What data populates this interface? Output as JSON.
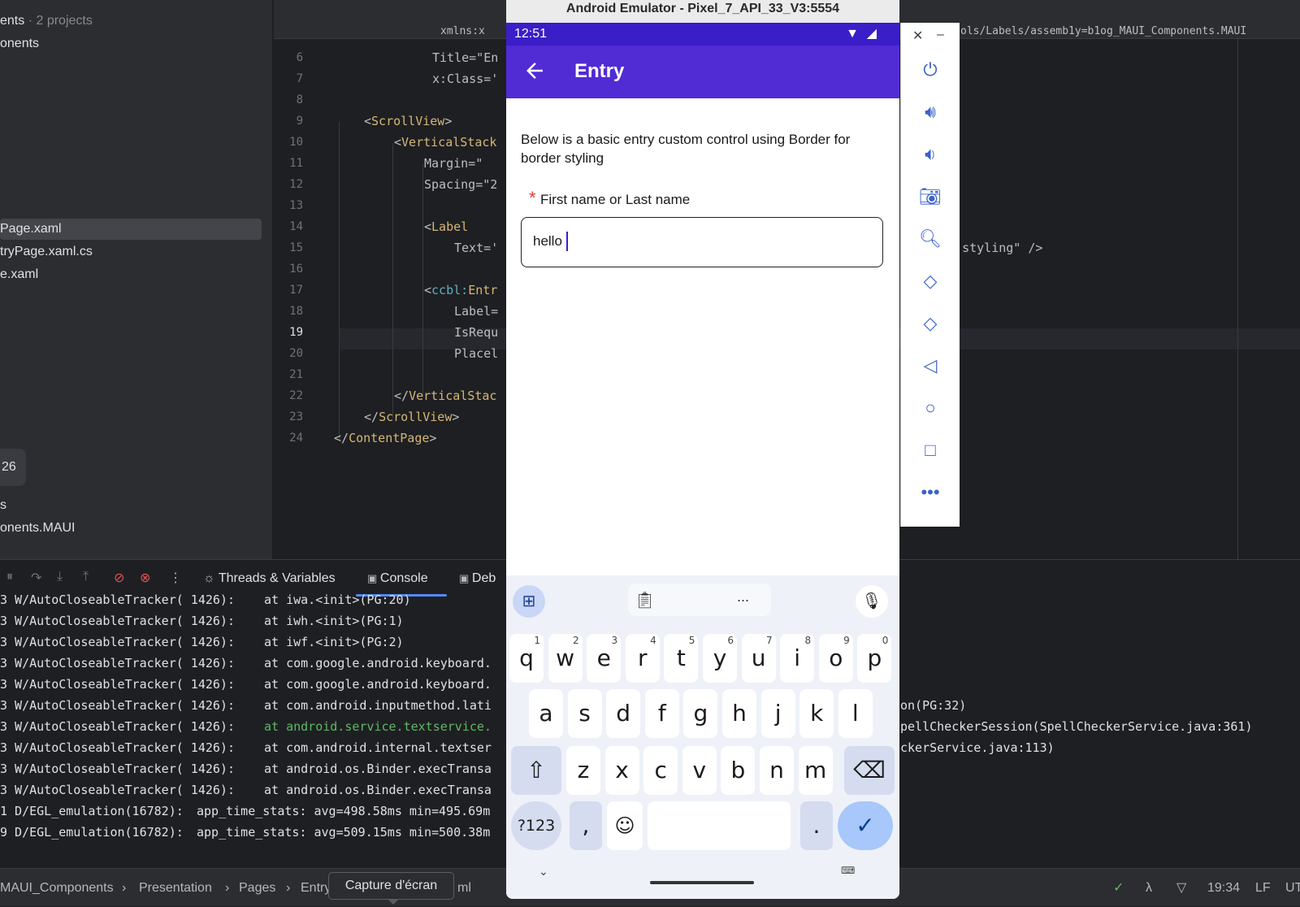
{
  "project_tree": {
    "header": "ents",
    "header_suffix": "· 2 projects",
    "items": [
      "onents",
      "Page.xaml",
      "tryPage.xaml.cs",
      "e.xaml",
      "26",
      "s",
      "onents.MAUI"
    ]
  },
  "editor": {
    "line_numbers": [
      "6",
      "7",
      "8",
      "9",
      "10",
      "11",
      "12",
      "13",
      "14",
      "15",
      "16",
      "17",
      "18",
      "19",
      "20",
      "21",
      "22",
      "23",
      "24"
    ],
    "current_line": "19",
    "top_fragment": "xmlns:x",
    "top_right_fragment": "ols/Labels/assemb1y=b1og_MAUI_Components.MAUI",
    "lines": {
      "l6": "Title=\"En",
      "l7": "x:Class='",
      "l9_tag": "ScrollView",
      "l10_tag": "VerticalStack",
      "l11": "Margin=\"",
      "l12": "Spacing=\"2",
      "l14_tag": "Label",
      "l15": "Text='",
      "l15_right": "er styling\" />",
      "l17_prefix": "ccbl:",
      "l17_tag": "Entr",
      "l18": "Label=",
      "l19": "IsRequ",
      "l20": "Placel",
      "l22_tag": "VerticalStac",
      "l23_tag": "ScrollView",
      "l24_tag": "ContentPage"
    }
  },
  "debug": {
    "tabs": {
      "threads": "Threads & Variables",
      "console": "Console",
      "debug": "Deb"
    },
    "logs": [
      {
        "prefix": "3 W/AutoCloseableTracker( 1426):",
        "body": "at iwa.<init>(PG:20)",
        "right": ""
      },
      {
        "prefix": "3 W/AutoCloseableTracker( 1426):",
        "body": "at iwh.<init>(PG:1)",
        "right": ""
      },
      {
        "prefix": "3 W/AutoCloseableTracker( 1426):",
        "body": "at iwf.<init>(PG:2)",
        "right": ""
      },
      {
        "prefix": "3 W/AutoCloseableTracker( 1426):",
        "body": "at com.google.android.keyboard.",
        "right": ""
      },
      {
        "prefix": "3 W/AutoCloseableTracker( 1426):",
        "body": "at com.google.android.keyboard.",
        "right": ""
      },
      {
        "prefix": "3 W/AutoCloseableTracker( 1426):",
        "body": "at com.android.inputmethod.lati",
        "right": "on(PG:32)"
      },
      {
        "prefix": "3 W/AutoCloseableTracker( 1426):",
        "body": "at android.service.textservice.",
        "right": "pellCheckerSession(SpellCheckerService.java:361)"
      },
      {
        "prefix": "3 W/AutoCloseableTracker( 1426):",
        "body": "at com.android.internal.textser",
        "right": "ckerService.java:113)"
      },
      {
        "prefix": "3 W/AutoCloseableTracker( 1426):",
        "body": "at android.os.Binder.execTransa",
        "right": ""
      },
      {
        "prefix": "3 W/AutoCloseableTracker( 1426):",
        "body": "at android.os.Binder.execTransa",
        "right": ""
      },
      {
        "prefix": "1 D/EGL_emulation(16782):",
        "body": "app_time_stats: avg=498.58ms min=495.69m",
        "right": ""
      },
      {
        "prefix": "9 D/EGL_emulation(16782):",
        "body": "app_time_stats: avg=509.15ms min=500.38m",
        "right": ""
      }
    ]
  },
  "status_bar": {
    "crumbs": [
      "MAUI_Components",
      "Presentation",
      "Pages",
      "Entry",
      "ml"
    ],
    "time": "19:34",
    "line_ending": "LF",
    "encoding": "UT"
  },
  "tooltip": "Capture d'écran",
  "emulator": {
    "window_title": "Android Emulator - Pixel_7_API_33_V3:5554",
    "clock": "12:51",
    "app_title": "Entry",
    "description": "Below is a basic entry custom control using Border for border styling",
    "required_mark": "*",
    "field_label": "First name or Last name",
    "entry_value": "hello",
    "suggestion_dots": "...",
    "keyboard": {
      "row1": [
        [
          "q",
          "1"
        ],
        [
          "w",
          "2"
        ],
        [
          "e",
          "3"
        ],
        [
          "r",
          "4"
        ],
        [
          "t",
          "5"
        ],
        [
          "y",
          "6"
        ],
        [
          "u",
          "7"
        ],
        [
          "i",
          "8"
        ],
        [
          "o",
          "9"
        ],
        [
          "p",
          "0"
        ]
      ],
      "row2": [
        "a",
        "s",
        "d",
        "f",
        "g",
        "h",
        "j",
        "k",
        "l"
      ],
      "row3": [
        "z",
        "x",
        "c",
        "v",
        "b",
        "n",
        "m"
      ],
      "symbols_key": "?123",
      "comma": ",",
      "period": "."
    },
    "colors": {
      "status_bar": "#3a1ec7",
      "app_bar": "#512bd4",
      "required": "#e53935",
      "action_key": "#a8c7fa"
    }
  }
}
